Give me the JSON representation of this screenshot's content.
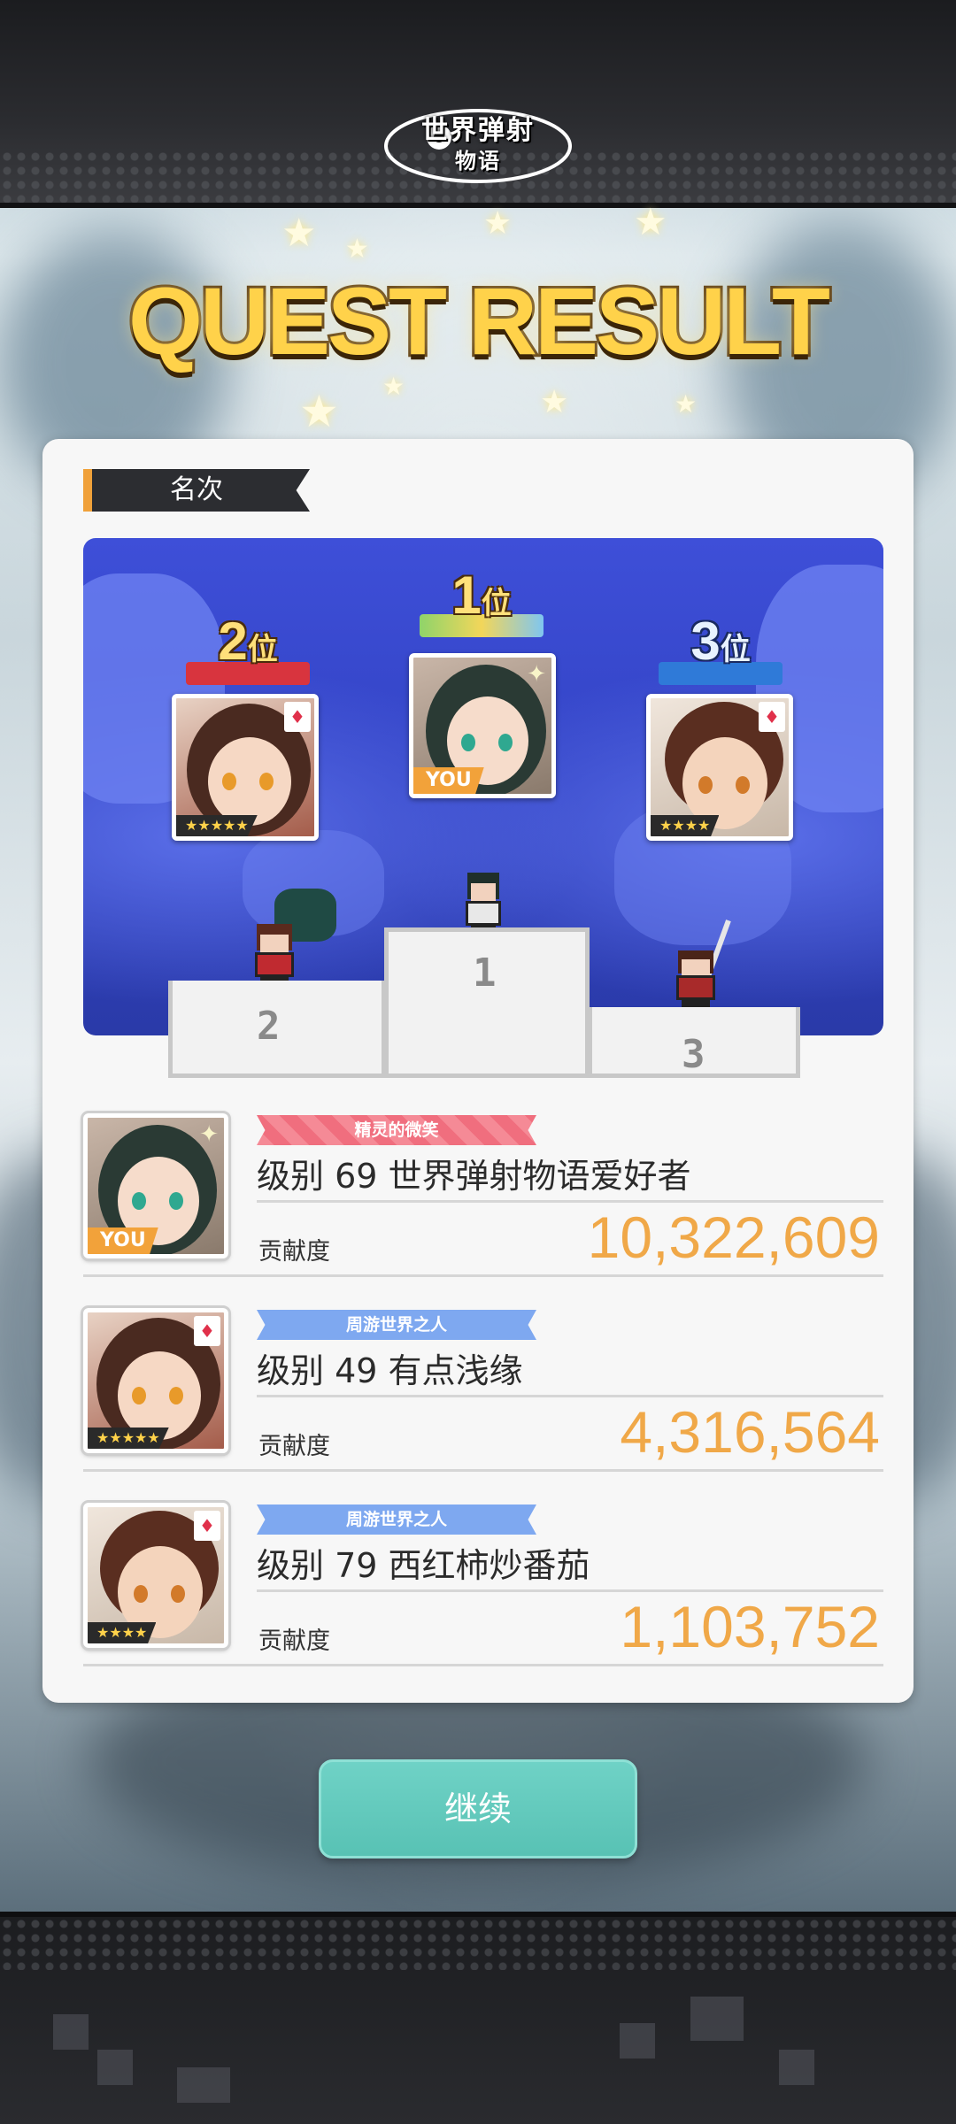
{
  "app": {
    "logo_text_line1": "世界弹射",
    "logo_text_line2": "物语"
  },
  "header": {
    "title": "QUEST RESULT"
  },
  "ranking": {
    "section_label": "名次",
    "podium": [
      {
        "rank": "1",
        "unit": "位",
        "you": true
      },
      {
        "rank": "2",
        "unit": "位",
        "stars": "★★★★★"
      },
      {
        "rank": "3",
        "unit": "位",
        "stars": "★★★★"
      }
    ],
    "pedestal_numbers": [
      "1",
      "2",
      "3"
    ],
    "you_label": "YOU"
  },
  "results": [
    {
      "title_badge": "精灵的微笑",
      "badge_color": "#f27b8a",
      "player": "级别 69 世界弹射物语爱好者",
      "contribution_label": "贡献度",
      "score": "10,322,609",
      "you": true
    },
    {
      "title_badge": "周游世界之人",
      "badge_color": "#7ea8f0",
      "player": "级别 49 有点浅缘",
      "contribution_label": "贡献度",
      "score": "4,316,564",
      "stars": "★★★★★"
    },
    {
      "title_badge": "周游世界之人",
      "badge_color": "#7ea8f0",
      "player": "级别 79 西红柿炒番茄",
      "contribution_label": "贡献度",
      "score": "1,103,752",
      "stars": "★★★★"
    }
  ],
  "actions": {
    "continue_label": "继续"
  },
  "colors": {
    "title_gold": "#ffd24a",
    "score_orange": "#f0a848",
    "continue_teal": "#58c2b4",
    "scene_blue": "#3243c4"
  }
}
